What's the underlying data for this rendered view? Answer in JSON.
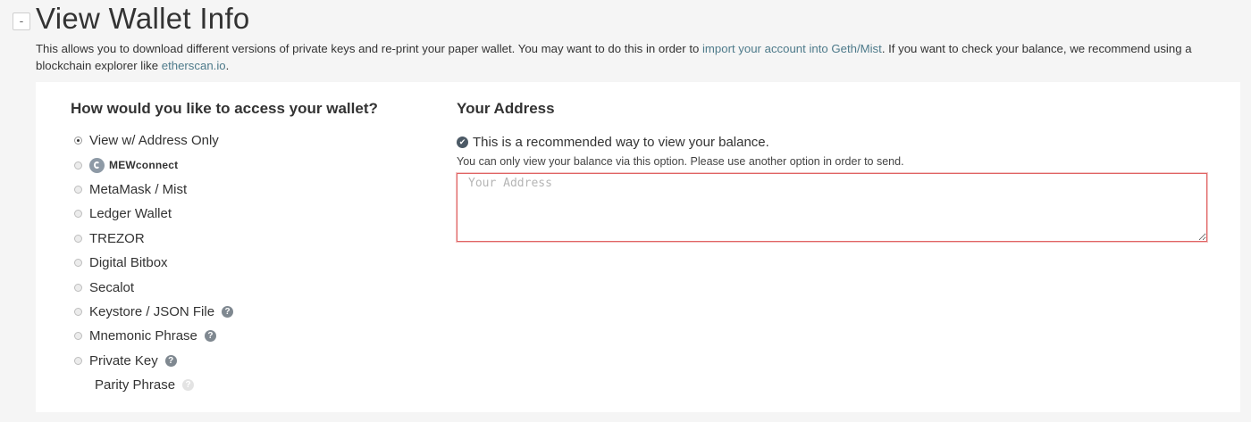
{
  "header": {
    "collapse_label": "-",
    "title": "View Wallet Info",
    "desc_part1": "This allows you to download different versions of private keys and re-print your paper wallet. You may want to do this in order to ",
    "link_geth": "import your account into Geth/Mist",
    "desc_part2": ". If you want to check your balance, we recommend using a blockchain explorer like ",
    "link_etherscan": "etherscan.io",
    "desc_part3": "."
  },
  "access": {
    "heading": "How would you like to access your wallet?",
    "options": [
      {
        "label": "View w/ Address Only",
        "selected": true
      },
      {
        "label": "MEWconnect",
        "icon": "mewconnect-logo-icon"
      },
      {
        "label": "MetaMask / Mist"
      },
      {
        "label": "Ledger Wallet"
      },
      {
        "label": "TREZOR"
      },
      {
        "label": "Digital Bitbox"
      },
      {
        "label": "Secalot"
      },
      {
        "label": "Keystore / JSON File",
        "help": true
      },
      {
        "label": "Mnemonic Phrase",
        "help": true
      },
      {
        "label": "Private Key",
        "help": true
      }
    ],
    "parity_label": "Parity Phrase",
    "help_glyph": "?"
  },
  "address": {
    "heading": "Your Address",
    "check_glyph": "✔",
    "recommend": "This is a recommended way to view your balance.",
    "note": "You can only view your balance via this option. Please use another option in order to send.",
    "placeholder": "Your Address",
    "value": ""
  },
  "colors": {
    "link": "#4d7a8a",
    "input_error_border": "#e06464",
    "panel_bg": "#ffffff",
    "page_bg": "#f5f5f5"
  }
}
